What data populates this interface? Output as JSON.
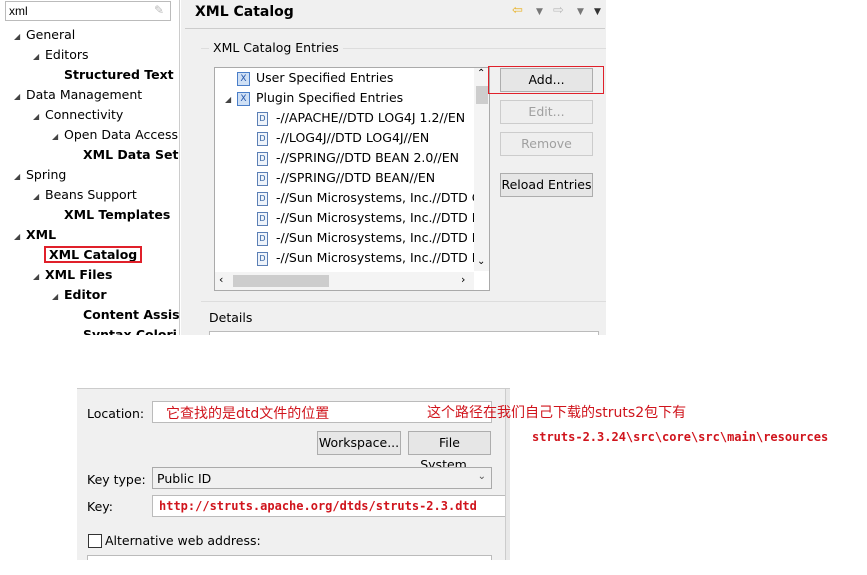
{
  "filter": {
    "value": "xml"
  },
  "tree": [
    {
      "label": "General",
      "level": 0,
      "bold": false,
      "expanded": true
    },
    {
      "label": "Editors",
      "level": 1,
      "bold": false,
      "expanded": true
    },
    {
      "label": "Structured Text E",
      "level": 2,
      "bold": true
    },
    {
      "label": "Data Management",
      "level": 0,
      "bold": false,
      "expanded": true
    },
    {
      "label": "Connectivity",
      "level": 1,
      "bold": false,
      "expanded": true
    },
    {
      "label": "Open Data Access",
      "level": 2,
      "bold": false,
      "expanded": true
    },
    {
      "label": "XML Data Set",
      "level": 3,
      "bold": true
    },
    {
      "label": "Spring",
      "level": 0,
      "bold": false,
      "expanded": true
    },
    {
      "label": "Beans Support",
      "level": 1,
      "bold": false,
      "expanded": true
    },
    {
      "label": "XML Templates",
      "level": 2,
      "bold": true
    },
    {
      "label": "XML",
      "level": 0,
      "bold": true,
      "expanded": true
    },
    {
      "label": "XML Catalog",
      "level": 1,
      "bold": true,
      "selected": true
    },
    {
      "label": "XML Files",
      "level": 1,
      "bold": true,
      "expanded": true
    },
    {
      "label": "Editor",
      "level": 2,
      "bold": true,
      "expanded": true
    },
    {
      "label": "Content Assis",
      "level": 3,
      "bold": true
    },
    {
      "label": "Syntax Colori",
      "level": 3,
      "bold": true
    }
  ],
  "page": {
    "title": "XML Catalog",
    "group_label": "XML Catalog Entries",
    "details_label": "Details"
  },
  "entries": [
    {
      "label": "User Specified Entries",
      "type": "catalog"
    },
    {
      "label": "Plugin Specified Entries",
      "type": "catalog",
      "expanded": true
    },
    {
      "label": "-//APACHE//DTD LOG4J 1.2//EN",
      "type": "dtd"
    },
    {
      "label": "-//LOG4J//DTD LOG4J//EN",
      "type": "dtd"
    },
    {
      "label": "-//SPRING//DTD BEAN 2.0//EN",
      "type": "dtd"
    },
    {
      "label": "-//SPRING//DTD BEAN//EN",
      "type": "dtd"
    },
    {
      "label": "-//Sun Microsystems, Inc.//DTD C",
      "type": "dtd"
    },
    {
      "label": "-//Sun Microsystems, Inc.//DTD E",
      "type": "dtd"
    },
    {
      "label": "-//Sun Microsystems, Inc.//DTD E",
      "type": "dtd"
    },
    {
      "label": "-//Sun Microsystems, Inc.//DTD F",
      "type": "dtd"
    }
  ],
  "buttons": {
    "add": "Add...",
    "edit": "Edit...",
    "remove": "Remove",
    "reload": "Reload Entries"
  },
  "dialog": {
    "location_label": "Location:",
    "location_value": "",
    "workspace": "Workspace...",
    "filesystem": "File System...",
    "keytype_label": "Key type:",
    "keytype_value": "Public ID",
    "key_label": "Key:",
    "alt_label": "Alternative web address:",
    "alt_checked": false
  },
  "annotations": {
    "location_note": "它查找的是dtd文件的位置",
    "path_note": "这个路径在我们自己下载的struts2包下有",
    "path": "struts-2.3.24\\src\\core\\src\\main\\resources",
    "key_value": "http://struts.apache.org/dtds/struts-2.3.dtd"
  },
  "colors": {
    "annotation": "#d0141c",
    "highlight_box": "#e0202a"
  }
}
